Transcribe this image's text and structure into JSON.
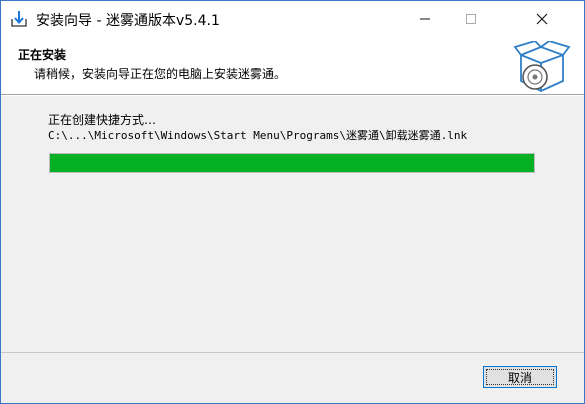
{
  "window": {
    "title": "安装向导 - 迷雾通版本v5.4.1",
    "minimize_glyph": "—",
    "maximize_glyph": "☐",
    "close_glyph": "✕"
  },
  "header": {
    "title": "正在安装",
    "subtitle": "请稍候，安装向导正在您的电脑上安装迷雾通。"
  },
  "main": {
    "status_text": "正在创建快捷方式…",
    "current_path": "C:\\...\\Microsoft\\Windows\\Start Menu\\Programs\\迷雾通\\卸载迷雾通.lnk",
    "progress": {
      "percent": 100,
      "fill_color": "#06b025"
    }
  },
  "footer": {
    "cancel_label": "取消"
  },
  "icons": {
    "title_icon": "install-icon",
    "header_logo": "box-disc-icon"
  }
}
